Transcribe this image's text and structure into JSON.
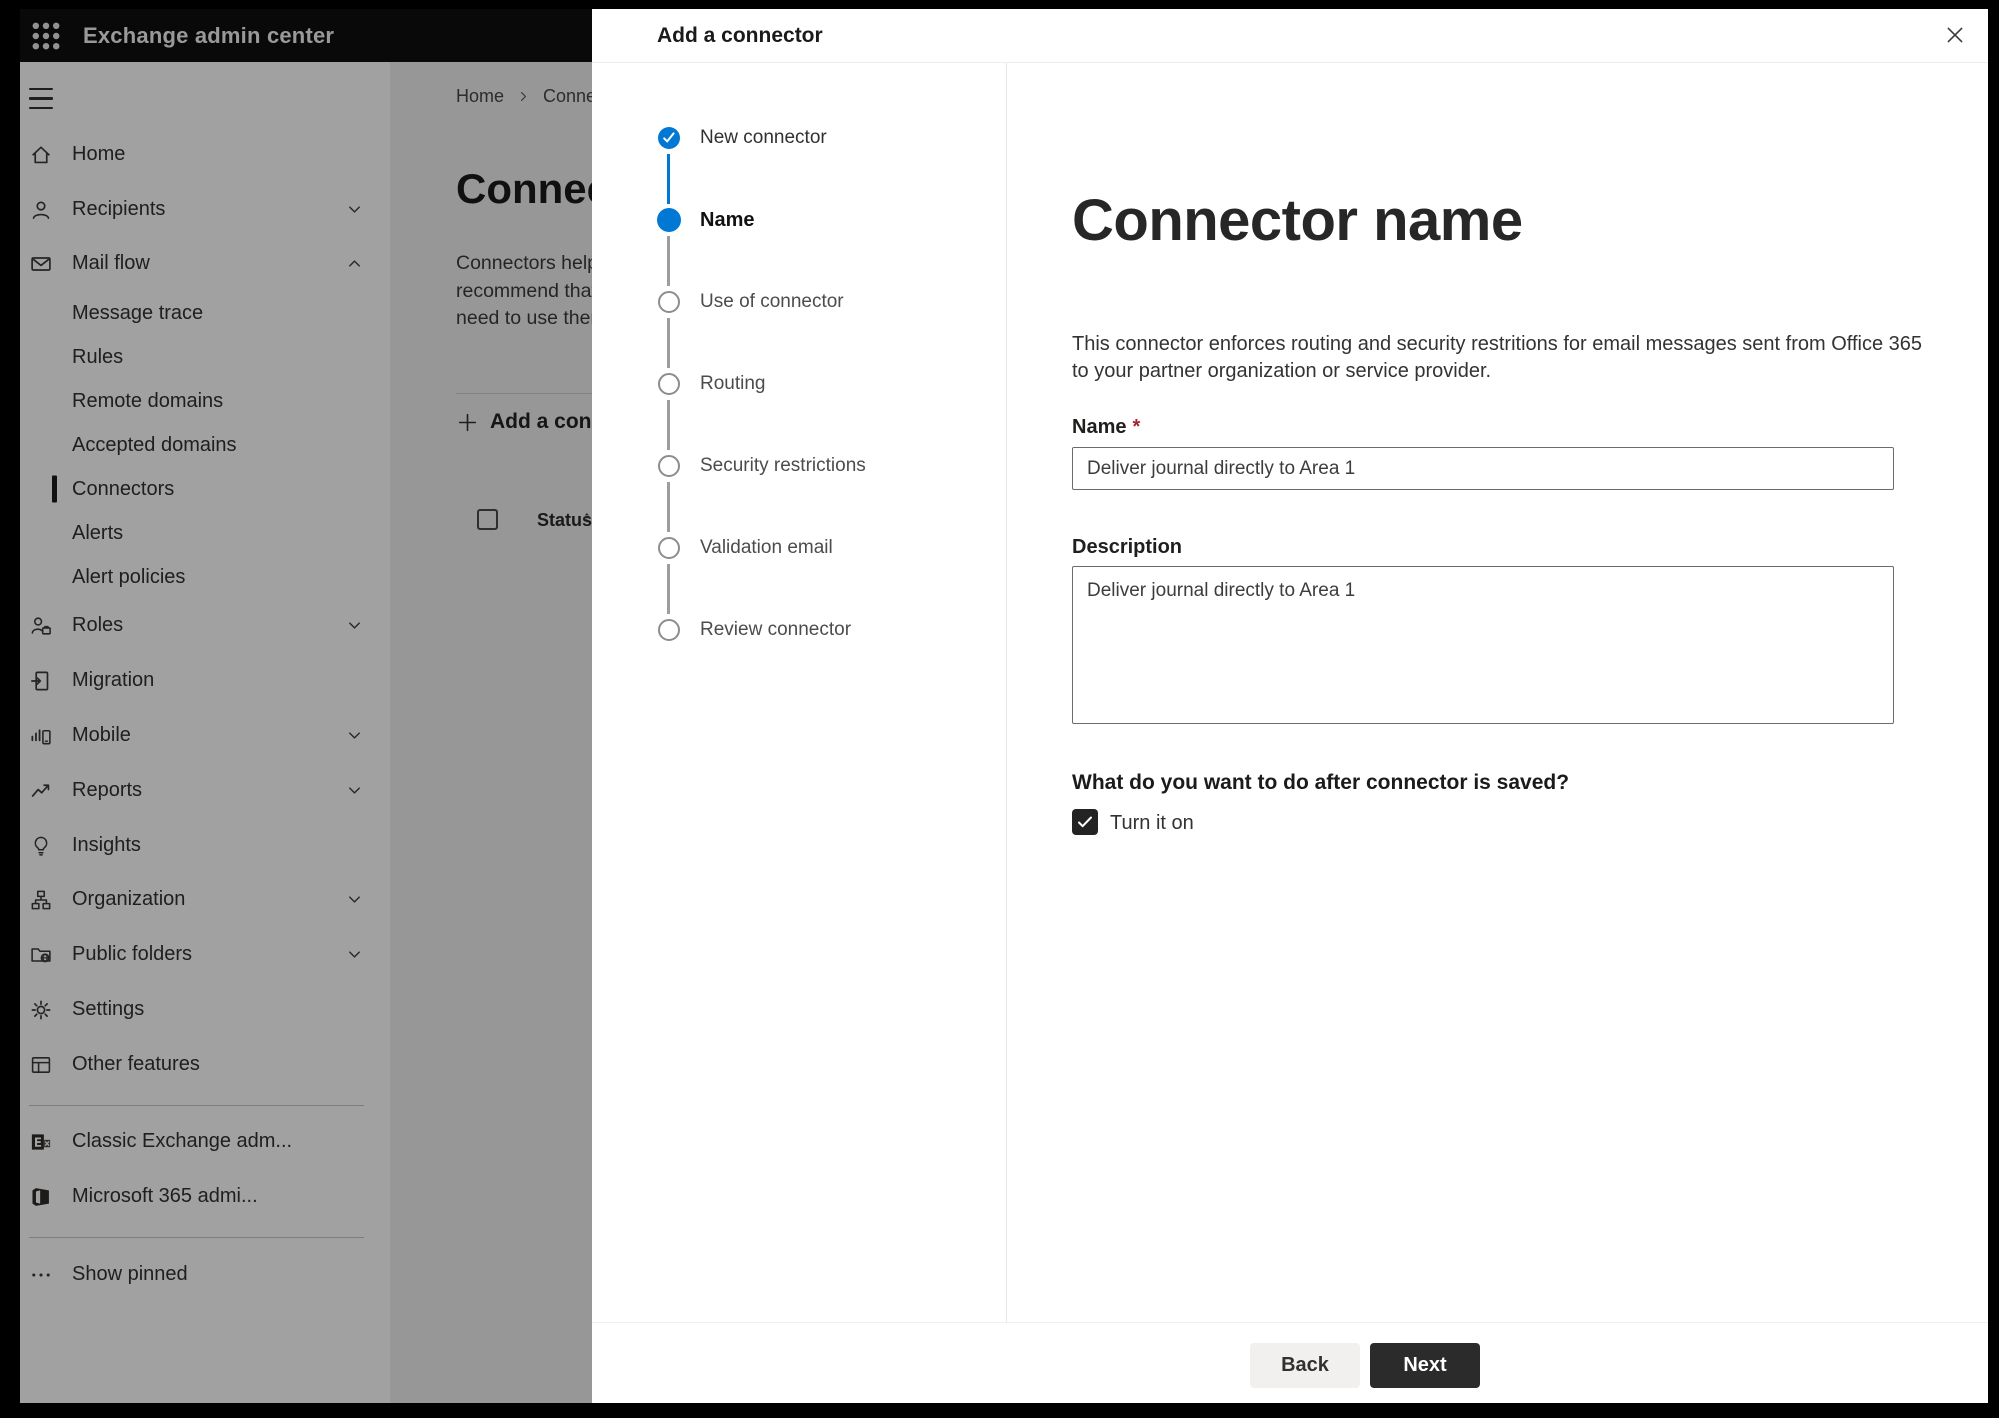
{
  "topbar": {
    "title": "Exchange admin center"
  },
  "sidebar": {
    "items": [
      {
        "label": "Home",
        "icon": "home-icon"
      },
      {
        "label": "Recipients",
        "icon": "person-icon",
        "chevron": "down"
      },
      {
        "label": "Mail flow",
        "icon": "mail-icon",
        "chevron": "up",
        "expanded": true
      },
      {
        "label": "Message trace",
        "sub": true
      },
      {
        "label": "Rules",
        "sub": true
      },
      {
        "label": "Remote domains",
        "sub": true
      },
      {
        "label": "Accepted domains",
        "sub": true
      },
      {
        "label": "Connectors",
        "sub": true,
        "selected": true
      },
      {
        "label": "Alerts",
        "sub": true
      },
      {
        "label": "Alert policies",
        "sub": true
      },
      {
        "label": "Roles",
        "icon": "roles-icon",
        "chevron": "down"
      },
      {
        "label": "Migration",
        "icon": "migration-icon"
      },
      {
        "label": "Mobile",
        "icon": "mobile-icon",
        "chevron": "down"
      },
      {
        "label": "Reports",
        "icon": "reports-icon",
        "chevron": "down"
      },
      {
        "label": "Insights",
        "icon": "lightbulb-icon"
      },
      {
        "label": "Organization",
        "icon": "org-chart-icon",
        "chevron": "down"
      },
      {
        "label": "Public folders",
        "icon": "folder-globe-icon",
        "chevron": "down"
      },
      {
        "label": "Settings",
        "icon": "gear-icon"
      },
      {
        "label": "Other features",
        "icon": "grid-table-icon"
      },
      {
        "label": "Classic Exchange adm...",
        "icon": "exchange-logo-icon"
      },
      {
        "label": "Microsoft 365 admi...",
        "icon": "office-logo-icon"
      },
      {
        "label": "Show pinned",
        "icon": "ellipsis-icon"
      }
    ]
  },
  "page": {
    "breadcrumb": {
      "home": "Home",
      "separator": "›",
      "current": "Conne"
    },
    "title": "Connec",
    "description_lines": [
      "Connectors help",
      "recommend that",
      "need to use ther"
    ],
    "add_button": "Add a conn",
    "table": {
      "status_column": "Status",
      "sort_indicator": "↑"
    }
  },
  "dialog": {
    "title": "Add a connector",
    "steps": [
      {
        "label": "New connector",
        "state": "completed"
      },
      {
        "label": "Name",
        "state": "current"
      },
      {
        "label": "Use of connector",
        "state": "upcoming"
      },
      {
        "label": "Routing",
        "state": "upcoming"
      },
      {
        "label": "Security restrictions",
        "state": "upcoming"
      },
      {
        "label": "Validation email",
        "state": "upcoming"
      },
      {
        "label": "Review connector",
        "state": "upcoming"
      }
    ],
    "content": {
      "heading": "Connector name",
      "description_lines": [
        "This connector enforces routing and security restritions for email messages sent from Office 365",
        "to your partner organization or service provider."
      ],
      "name_label": "Name",
      "required_mark": "*",
      "name_value": "Deliver journal directly to Area 1",
      "description_label": "Description",
      "description_value": "Deliver journal directly to Area 1",
      "question": "What do you want to do after connector is saved?",
      "checkbox_label": "Turn it on",
      "checkbox_checked": true
    },
    "footer": {
      "back_label": "Back",
      "next_label": "Next"
    }
  },
  "colors": {
    "accent_blue": "#0078d4",
    "dark_button": "#2b2b2b",
    "required_red": "#a4262c",
    "topbar_bg": "#0f0f0f"
  }
}
